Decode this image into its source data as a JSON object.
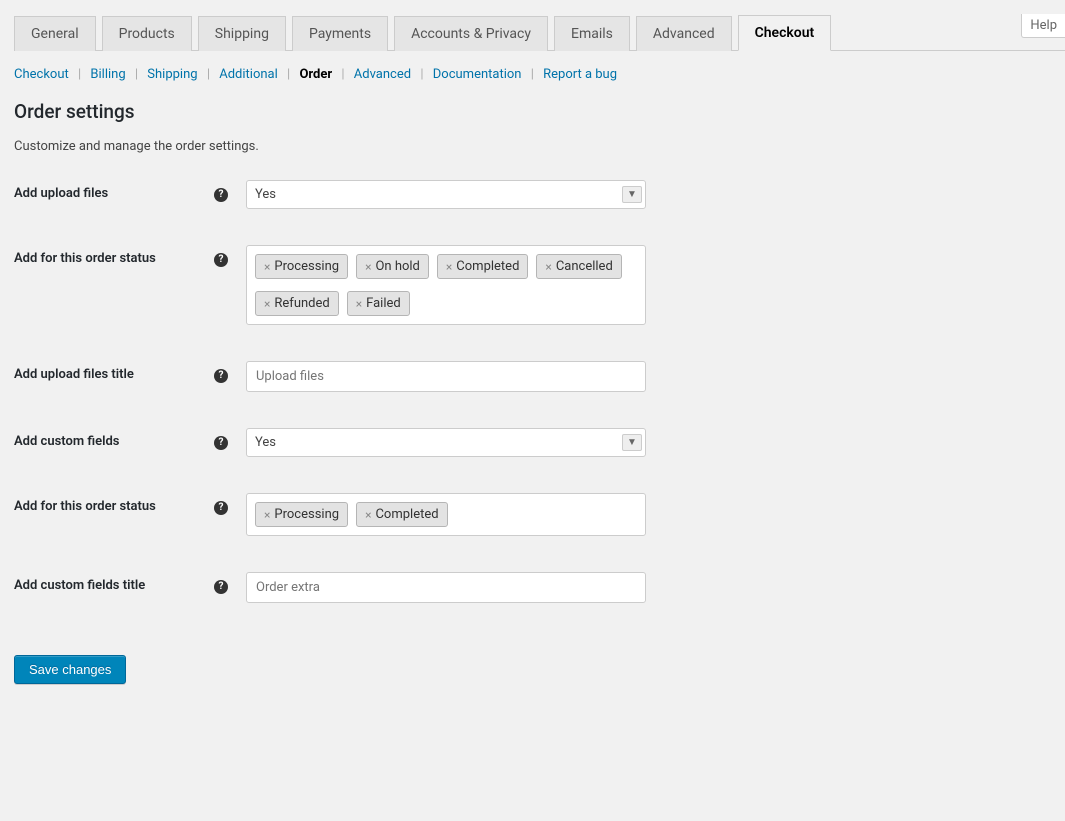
{
  "help_tab": "Help",
  "tabs": {
    "general": "General",
    "products": "Products",
    "shipping": "Shipping",
    "payments": "Payments",
    "accounts": "Accounts & Privacy",
    "emails": "Emails",
    "advanced": "Advanced",
    "checkout": "Checkout"
  },
  "subtabs": {
    "checkout": "Checkout",
    "billing": "Billing",
    "shipping": "Shipping",
    "additional": "Additional",
    "order": "Order",
    "advanced": "Advanced",
    "documentation": "Documentation",
    "report": "Report a bug"
  },
  "page": {
    "title": "Order settings",
    "desc": "Customize and manage the order settings."
  },
  "fields": {
    "add_upload_files": {
      "label": "Add upload files",
      "value": "Yes"
    },
    "upload_status": {
      "label": "Add for this order status",
      "tags": {
        "t0": "Processing",
        "t1": "On hold",
        "t2": "Completed",
        "t3": "Cancelled",
        "t4": "Refunded",
        "t5": "Failed"
      }
    },
    "upload_title": {
      "label": "Add upload files title",
      "placeholder": "Upload files"
    },
    "add_custom_fields": {
      "label": "Add custom fields",
      "value": "Yes"
    },
    "custom_status": {
      "label": "Add for this order status",
      "tags": {
        "t0": "Processing",
        "t1": "Completed"
      }
    },
    "custom_title": {
      "label": "Add custom fields title",
      "placeholder": "Order extra"
    }
  },
  "save_button": "Save changes"
}
